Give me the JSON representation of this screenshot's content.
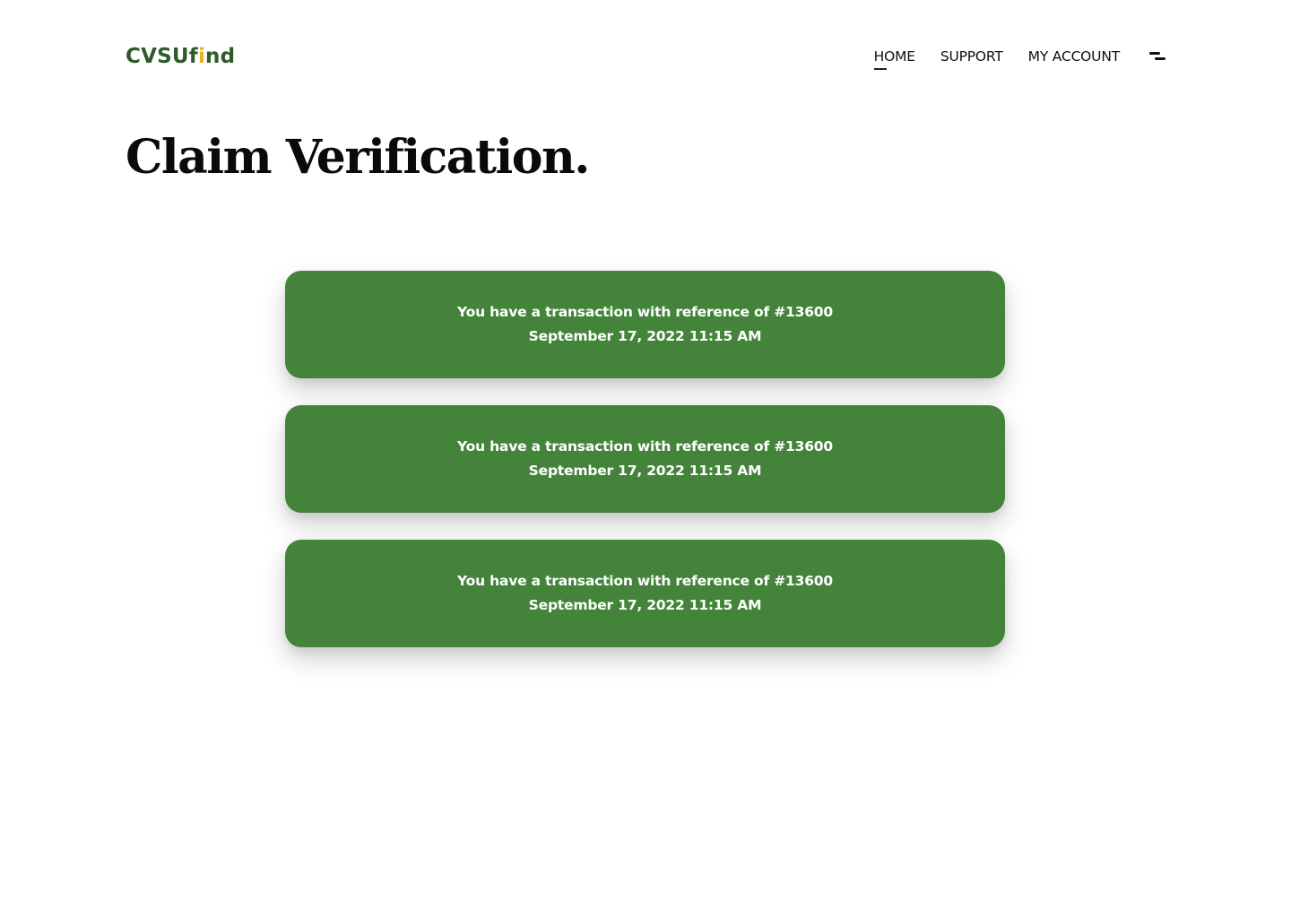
{
  "brand": {
    "logo_pre": "CVSUf",
    "logo_accent": "i",
    "logo_post": "nd",
    "primary_color": "#2f5a2a",
    "accent_color": "#e8b31c"
  },
  "nav": {
    "items": [
      {
        "label": "HOME",
        "active": true
      },
      {
        "label": "SUPPORT",
        "active": false
      },
      {
        "label": "MY ACCOUNT",
        "active": false
      }
    ],
    "menu_icon": "menu-icon"
  },
  "page": {
    "title": "Claim Verification."
  },
  "transactions": [
    {
      "message": "You have a transaction with reference of #13600",
      "datetime": "September 17, 2022 11:15 AM"
    },
    {
      "message": "You have a transaction with reference of #13600",
      "datetime": "September 17, 2022 11:15 AM"
    },
    {
      "message": "You have a transaction with reference of #13600",
      "datetime": "September 17, 2022 11:15 AM"
    }
  ],
  "colors": {
    "card_background": "#43843a",
    "card_text": "#ffffff"
  }
}
